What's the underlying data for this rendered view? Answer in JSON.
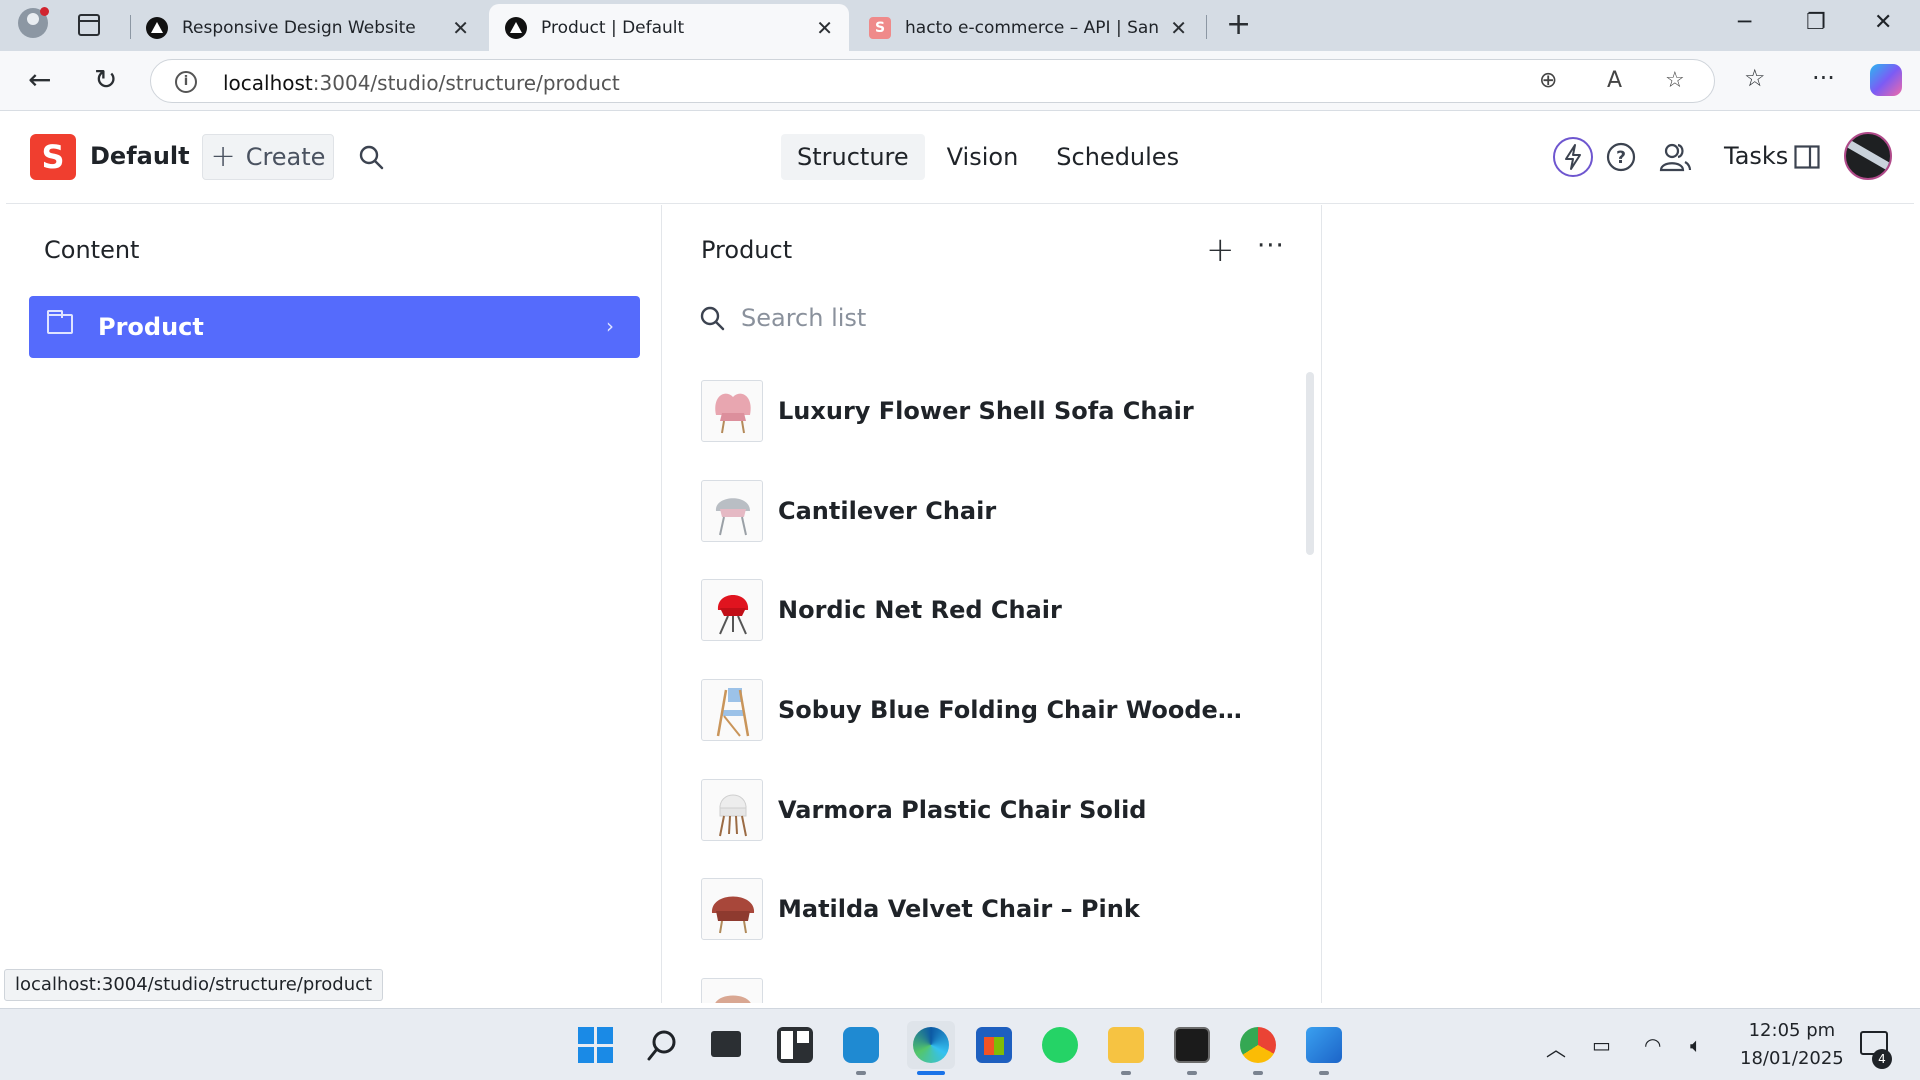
{
  "browser": {
    "tabs": [
      {
        "title": "Responsive Design Website",
        "active": false
      },
      {
        "title": "Product | Default",
        "active": true
      },
      {
        "title": "hacto e-commerce – API | Sanity.i",
        "active": false
      }
    ],
    "url_host": "localhost",
    "url_path": ":3004/studio/structure/product",
    "status_url": "localhost:3004/studio/structure/product"
  },
  "studio": {
    "logo_letter": "S",
    "workspace": "Default",
    "create_label": "Create",
    "nav_tabs": [
      "Structure",
      "Vision",
      "Schedules"
    ],
    "active_tab": "Structure",
    "tasks_label": "Tasks"
  },
  "content_pane": {
    "title": "Content",
    "items": [
      {
        "label": "Product",
        "selected": true
      }
    ]
  },
  "product_pane": {
    "title": "Product",
    "search_placeholder": "Search list",
    "items": [
      {
        "title": "Luxury Flower Shell Sofa Chair",
        "thumb": "pink-shell-chair"
      },
      {
        "title": "Cantilever Chair",
        "thumb": "grey-cantilever-chair"
      },
      {
        "title": "Nordic Net Red Chair",
        "thumb": "red-chair"
      },
      {
        "title": "Sobuy Blue Folding Chair Wooden Pad...",
        "thumb": "blue-folding-chair"
      },
      {
        "title": "Varmora Plastic Chair Solid",
        "thumb": "white-plastic-chair"
      },
      {
        "title": "Matilda Velvet Chair – Pink",
        "thumb": "velvet-chair"
      }
    ]
  },
  "taskbar": {
    "time": "12:05 pm",
    "date": "18/01/2025",
    "notification_count": "4"
  },
  "colors": {
    "accent": "#556bfc",
    "sanity_red": "#f03e2f"
  }
}
